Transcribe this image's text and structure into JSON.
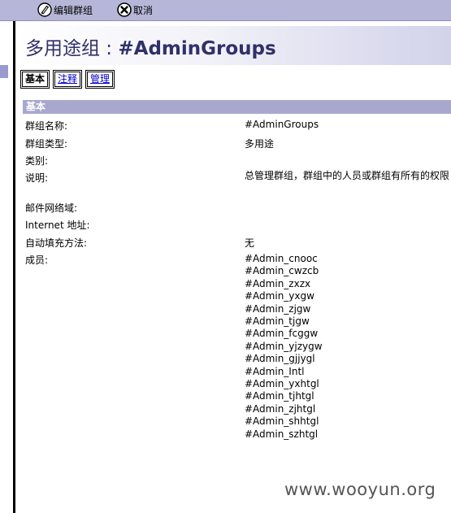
{
  "toolbar": {
    "edit_label": "编辑群组",
    "cancel_label": "取消"
  },
  "title": {
    "prefix": "多用途组 : ",
    "group_name": "#AdminGroups"
  },
  "tabs": [
    {
      "label": "基本",
      "active": true
    },
    {
      "label": "注释",
      "active": false
    },
    {
      "label": "管理",
      "active": false
    }
  ],
  "section": {
    "title": "基本"
  },
  "fields": {
    "group_name_label": "群组名称:",
    "group_name_value": "#AdminGroups",
    "group_type_label": "群组类型:",
    "group_type_value": "多用途",
    "category_label": "类别:",
    "description_label": "说明:",
    "description_value": "总管理群组，群组中的人员或群组有所有的权限",
    "mail_domain_label": "邮件网络域:",
    "internet_address_label": "Internet 地址:",
    "autofill_label": "自动填充方法:",
    "autofill_value": "无",
    "members_label": "成员:"
  },
  "members": [
    "#Admin_cnooc",
    "#Admin_cwzcb",
    "#Admin_zxzx",
    "#Admin_yxgw",
    "#Admin_zjgw",
    "#Admin_tjgw",
    "#Admin_fcggw",
    "#Admin_yjzygw",
    "#Admin_gjjygl",
    "#Admin_Intl",
    "#Admin_yxhtgl",
    "#Admin_tjhtgl",
    "#Admin_zjhtgl",
    "#Admin_shhtgl",
    "#Admin_szhtgl"
  ],
  "watermark": "www.wooyun.org",
  "colors": {
    "toolbar_bg": "#b6b6d8",
    "section_header_bg": "#a8a8cf",
    "title_text": "#30306a",
    "link": "#0000cc"
  }
}
